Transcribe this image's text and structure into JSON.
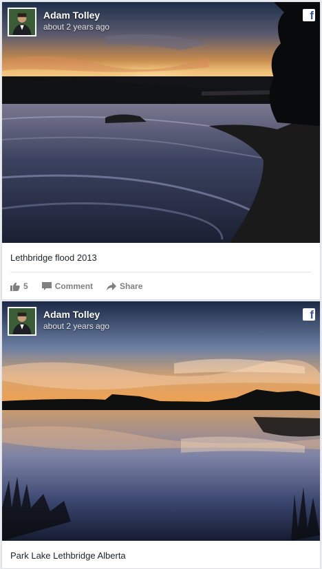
{
  "posts": [
    {
      "author": "Adam Tolley",
      "time": "about 2 years ago",
      "network_icon": "facebook-icon",
      "caption": "Lethbridge flood 2013",
      "likes": "5",
      "comment_label": "Comment",
      "share_label": "Share"
    },
    {
      "author": "Adam Tolley",
      "time": "about 2 years ago",
      "network_icon": "facebook-icon",
      "caption": "Park Lake Lethbridge Alberta"
    }
  ],
  "brand_color": "#3b5998"
}
